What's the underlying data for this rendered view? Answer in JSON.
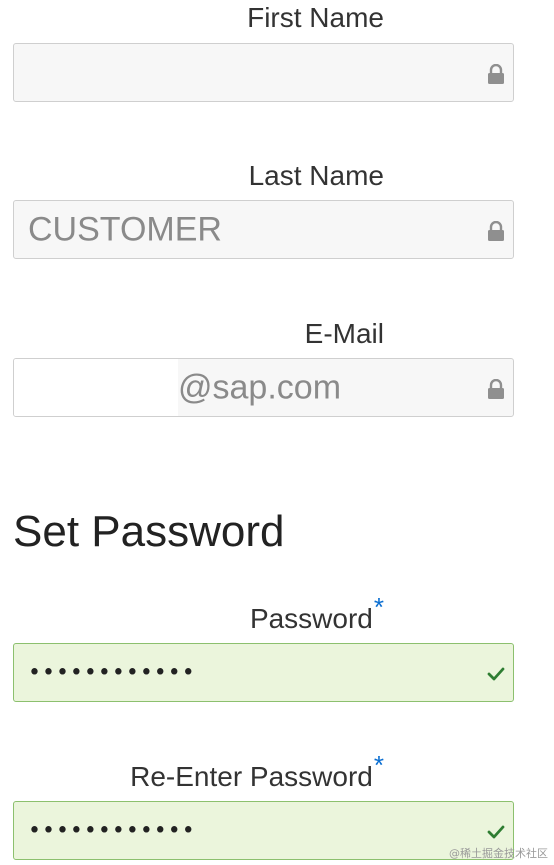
{
  "form": {
    "first_name": {
      "label": "First Name",
      "value": "",
      "locked": true
    },
    "last_name": {
      "label": "Last Name",
      "value": "CUSTOMER",
      "locked": true
    },
    "email": {
      "label": "E-Mail",
      "value": "@sap.com",
      "locked": true
    }
  },
  "set_password": {
    "heading": "Set Password",
    "password": {
      "label": "Password",
      "required_marker": "*",
      "masked_value": "••••••••••••",
      "valid": true
    },
    "reenter": {
      "label": "Re-Enter Password",
      "required_marker": "*",
      "masked_value": "••••••••••••",
      "valid": true
    }
  },
  "watermark": "@稀土掘金技术社区",
  "icons": {
    "lock": "lock-icon",
    "check": "checkmark-icon"
  },
  "colors": {
    "required": "#0a6ed1",
    "valid_bg": "#ebf5dc",
    "valid_border": "#8cc06e",
    "check": "#2e7d32",
    "lock": "#8f8f8f"
  }
}
